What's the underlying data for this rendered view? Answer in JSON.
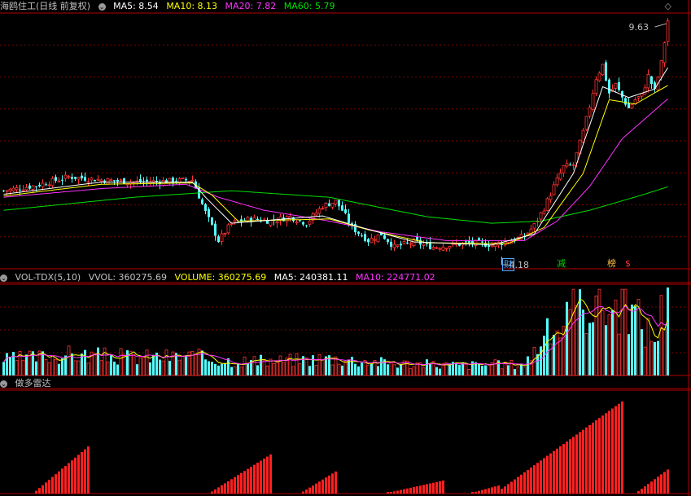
{
  "colors": {
    "up": "#ff3333",
    "down": "#54ffff",
    "ma5": "#ffffff",
    "ma10": "#ffff00",
    "ma20": "#ff33ff",
    "ma60": "#00e000",
    "grid": "#7a0000",
    "axis": "#b00000"
  },
  "header": {
    "title": "海鸥住工(日线 前复权)",
    "ma5": "MA5: 8.54",
    "ma10": "MA10: 8.13",
    "ma20": "MA20: 7.82",
    "ma60": "MA60: 5.79",
    "menu_icon": "chevron-down-icon",
    "corner_icon": "diamond-icon"
  },
  "vol_header": {
    "name": "VOL-TDX(5,10)",
    "vvol": "VVOL: 360275.69",
    "volume": "VOLUME: 360275.69",
    "ma5": "MA5: 240381.11",
    "ma10": "MA10: 224771.02",
    "menu_icon": "chevron-down-icon"
  },
  "ind_header": {
    "name": "做多雷达",
    "menu_icon": "chevron-down-icon"
  },
  "annotations": {
    "high_label": "9.63",
    "low_label": "4.18"
  },
  "event_tags": [
    {
      "text": "财",
      "color": "#54a8ff"
    },
    {
      "text": "减",
      "color": "#00d000"
    },
    {
      "text": "榜",
      "color": "#ffc040"
    },
    {
      "text": "$",
      "color": "#ff3333"
    }
  ],
  "chart_data": [
    {
      "type": "candlestick",
      "title": "海鸥住工(日线 前复权)",
      "ylim": [
        3.9,
        9.8
      ],
      "high": 9.63,
      "low": 4.18,
      "close_points": [
        [
          0,
          5.7
        ],
        [
          10,
          5.82
        ],
        [
          20,
          6.02
        ],
        [
          30,
          5.95
        ],
        [
          40,
          5.9
        ],
        [
          50,
          5.92
        ],
        [
          58,
          5.95
        ],
        [
          62,
          5.2
        ],
        [
          66,
          4.55
        ],
        [
          68,
          4.75
        ],
        [
          70,
          4.95
        ],
        [
          76,
          5.05
        ],
        [
          82,
          5.0
        ],
        [
          88,
          5.1
        ],
        [
          93,
          4.95
        ],
        [
          98,
          5.35
        ],
        [
          102,
          5.45
        ],
        [
          104,
          5.25
        ],
        [
          107,
          4.85
        ],
        [
          112,
          4.55
        ],
        [
          116,
          4.7
        ],
        [
          120,
          4.4
        ],
        [
          126,
          4.52
        ],
        [
          132,
          4.4
        ],
        [
          138,
          4.45
        ],
        [
          144,
          4.5
        ],
        [
          150,
          4.45
        ],
        [
          156,
          4.55
        ],
        [
          160,
          4.65
        ],
        [
          163,
          4.9
        ],
        [
          166,
          5.3
        ],
        [
          169,
          5.8
        ],
        [
          172,
          6.25
        ],
        [
          175,
          6.3
        ],
        [
          178,
          7.05
        ],
        [
          180,
          7.65
        ],
        [
          182,
          8.3
        ],
        [
          184,
          8.6
        ],
        [
          186,
          7.95
        ],
        [
          188,
          8.15
        ],
        [
          190,
          7.85
        ],
        [
          192,
          7.6
        ],
        [
          194,
          7.8
        ],
        [
          196,
          7.9
        ],
        [
          198,
          8.35
        ],
        [
          200,
          8.0
        ],
        [
          202,
          8.65
        ],
        [
          204,
          9.62
        ]
      ],
      "ma5": [
        [
          0,
          5.62
        ],
        [
          30,
          5.9
        ],
        [
          58,
          5.9
        ],
        [
          62,
          5.55
        ],
        [
          70,
          4.95
        ],
        [
          98,
          5.12
        ],
        [
          110,
          4.85
        ],
        [
          126,
          4.52
        ],
        [
          150,
          4.45
        ],
        [
          163,
          4.7
        ],
        [
          175,
          6.1
        ],
        [
          184,
          8.1
        ],
        [
          192,
          7.85
        ],
        [
          200,
          8.05
        ],
        [
          204,
          8.54
        ]
      ],
      "ma10": [
        [
          0,
          5.58
        ],
        [
          30,
          5.85
        ],
        [
          58,
          5.88
        ],
        [
          64,
          5.6
        ],
        [
          72,
          5.0
        ],
        [
          100,
          5.05
        ],
        [
          112,
          4.8
        ],
        [
          130,
          4.5
        ],
        [
          155,
          4.48
        ],
        [
          166,
          4.85
        ],
        [
          178,
          6.1
        ],
        [
          186,
          7.8
        ],
        [
          194,
          7.7
        ],
        [
          204,
          8.13
        ]
      ],
      "ma20": [
        [
          0,
          5.55
        ],
        [
          30,
          5.75
        ],
        [
          56,
          5.85
        ],
        [
          66,
          5.55
        ],
        [
          80,
          5.25
        ],
        [
          100,
          5.0
        ],
        [
          116,
          4.75
        ],
        [
          136,
          4.55
        ],
        [
          160,
          4.55
        ],
        [
          170,
          5.0
        ],
        [
          180,
          5.8
        ],
        [
          190,
          6.9
        ],
        [
          204,
          7.82
        ]
      ],
      "ma60": [
        [
          0,
          5.25
        ],
        [
          40,
          5.55
        ],
        [
          70,
          5.7
        ],
        [
          100,
          5.55
        ],
        [
          130,
          5.1
        ],
        [
          150,
          4.95
        ],
        [
          165,
          5.0
        ],
        [
          180,
          5.25
        ],
        [
          196,
          5.6
        ],
        [
          204,
          5.79
        ]
      ]
    },
    {
      "type": "bar",
      "title": "VOL-TDX(5,10)",
      "ylim": [
        0,
        360275.69
      ],
      "latest_volume": 360275.69,
      "ma5": 240381.11,
      "ma10": 224771.02,
      "level_points": [
        [
          0,
          0.18
        ],
        [
          20,
          0.24
        ],
        [
          40,
          0.21
        ],
        [
          58,
          0.22
        ],
        [
          66,
          0.18
        ],
        [
          80,
          0.16
        ],
        [
          100,
          0.2
        ],
        [
          120,
          0.14
        ],
        [
          140,
          0.12
        ],
        [
          160,
          0.13
        ],
        [
          165,
          0.4
        ],
        [
          170,
          0.55
        ],
        [
          178,
          0.78
        ],
        [
          182,
          0.95
        ],
        [
          186,
          0.75
        ],
        [
          190,
          0.85
        ],
        [
          196,
          0.6
        ],
        [
          200,
          0.42
        ],
        [
          204,
          1.0
        ]
      ]
    },
    {
      "type": "bar",
      "title": "做多雷达",
      "series": [
        {
          "start": 10,
          "end": 26,
          "peak": 0.47
        },
        {
          "start": 64,
          "end": 82,
          "peak": 0.39
        },
        {
          "start": 92,
          "end": 102,
          "peak": 0.22
        },
        {
          "start": 118,
          "end": 135,
          "peak": 0.13
        },
        {
          "start": 144,
          "end": 152,
          "peak": 0.08
        },
        {
          "start": 152,
          "end": 190,
          "peak": 0.92
        },
        {
          "start": 195,
          "end": 204,
          "peak": 0.24
        }
      ]
    }
  ]
}
